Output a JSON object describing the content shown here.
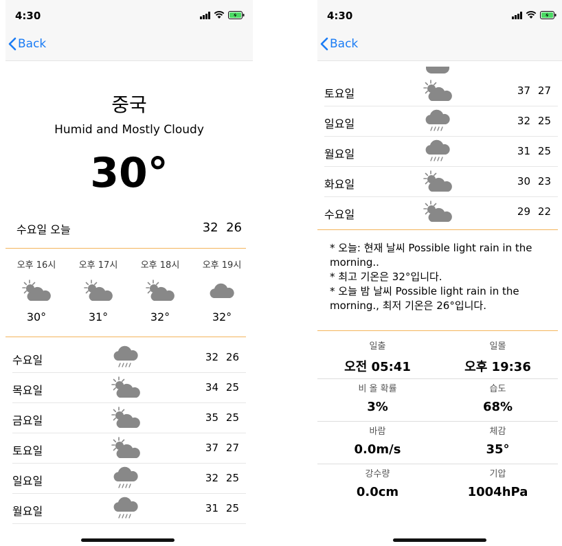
{
  "status": {
    "time": "4:30"
  },
  "nav": {
    "back_label": "Back"
  },
  "left": {
    "city": "중국",
    "summary": "Humid and Mostly Cloudy",
    "temperature": "30°",
    "today": {
      "label": "수요일  오늘",
      "high": "32",
      "low": "26"
    },
    "hourly": [
      {
        "label": "오후 16시",
        "icon": "partly-cloudy-icon",
        "temp": "30°"
      },
      {
        "label": "오후 17시",
        "icon": "partly-cloudy-icon",
        "temp": "31°"
      },
      {
        "label": "오후 18시",
        "icon": "partly-cloudy-icon",
        "temp": "32°"
      },
      {
        "label": "오후 19시",
        "icon": "cloud-icon",
        "temp": "32°"
      }
    ],
    "daily": [
      {
        "day": "수요일",
        "icon": "rain-icon",
        "high": "32",
        "low": "26"
      },
      {
        "day": "목요일",
        "icon": "partly-cloudy-icon",
        "high": "34",
        "low": "25"
      },
      {
        "day": "금요일",
        "icon": "partly-cloudy-icon",
        "high": "35",
        "low": "25"
      },
      {
        "day": "토요일",
        "icon": "partly-cloudy-icon",
        "high": "37",
        "low": "27"
      },
      {
        "day": "일요일",
        "icon": "rain-icon",
        "high": "32",
        "low": "25"
      },
      {
        "day": "월요일",
        "icon": "rain-icon",
        "high": "31",
        "low": "25"
      }
    ]
  },
  "right": {
    "daily": [
      {
        "day": "토요일",
        "icon": "partly-cloudy-icon",
        "high": "37",
        "low": "27"
      },
      {
        "day": "일요일",
        "icon": "rain-icon",
        "high": "32",
        "low": "25"
      },
      {
        "day": "월요일",
        "icon": "rain-icon",
        "high": "31",
        "low": "25"
      },
      {
        "day": "화요일",
        "icon": "partly-cloudy-icon",
        "high": "30",
        "low": "23"
      },
      {
        "day": "수요일",
        "icon": "partly-cloudy-icon",
        "high": "29",
        "low": "22"
      }
    ],
    "notes": [
      "* 오늘: 현재 날씨 Possible light rain in the morning..",
      "* 최고 기온은 32°입니다.",
      "* 오늘 밤 날씨 Possible light rain in the morning., 최저 기온은 26°입니다."
    ],
    "details": [
      {
        "label": "일출",
        "value": "오전 05:41"
      },
      {
        "label": "일몰",
        "value": "오후 19:36"
      },
      {
        "label": "비 올 확률",
        "value": "3%"
      },
      {
        "label": "습도",
        "value": "68%"
      },
      {
        "label": "바람",
        "value": "0.0m/s"
      },
      {
        "label": "체감",
        "value": "35°"
      },
      {
        "label": "강수량",
        "value": "0.0cm"
      },
      {
        "label": "기압",
        "value": "1004hPa"
      }
    ]
  }
}
